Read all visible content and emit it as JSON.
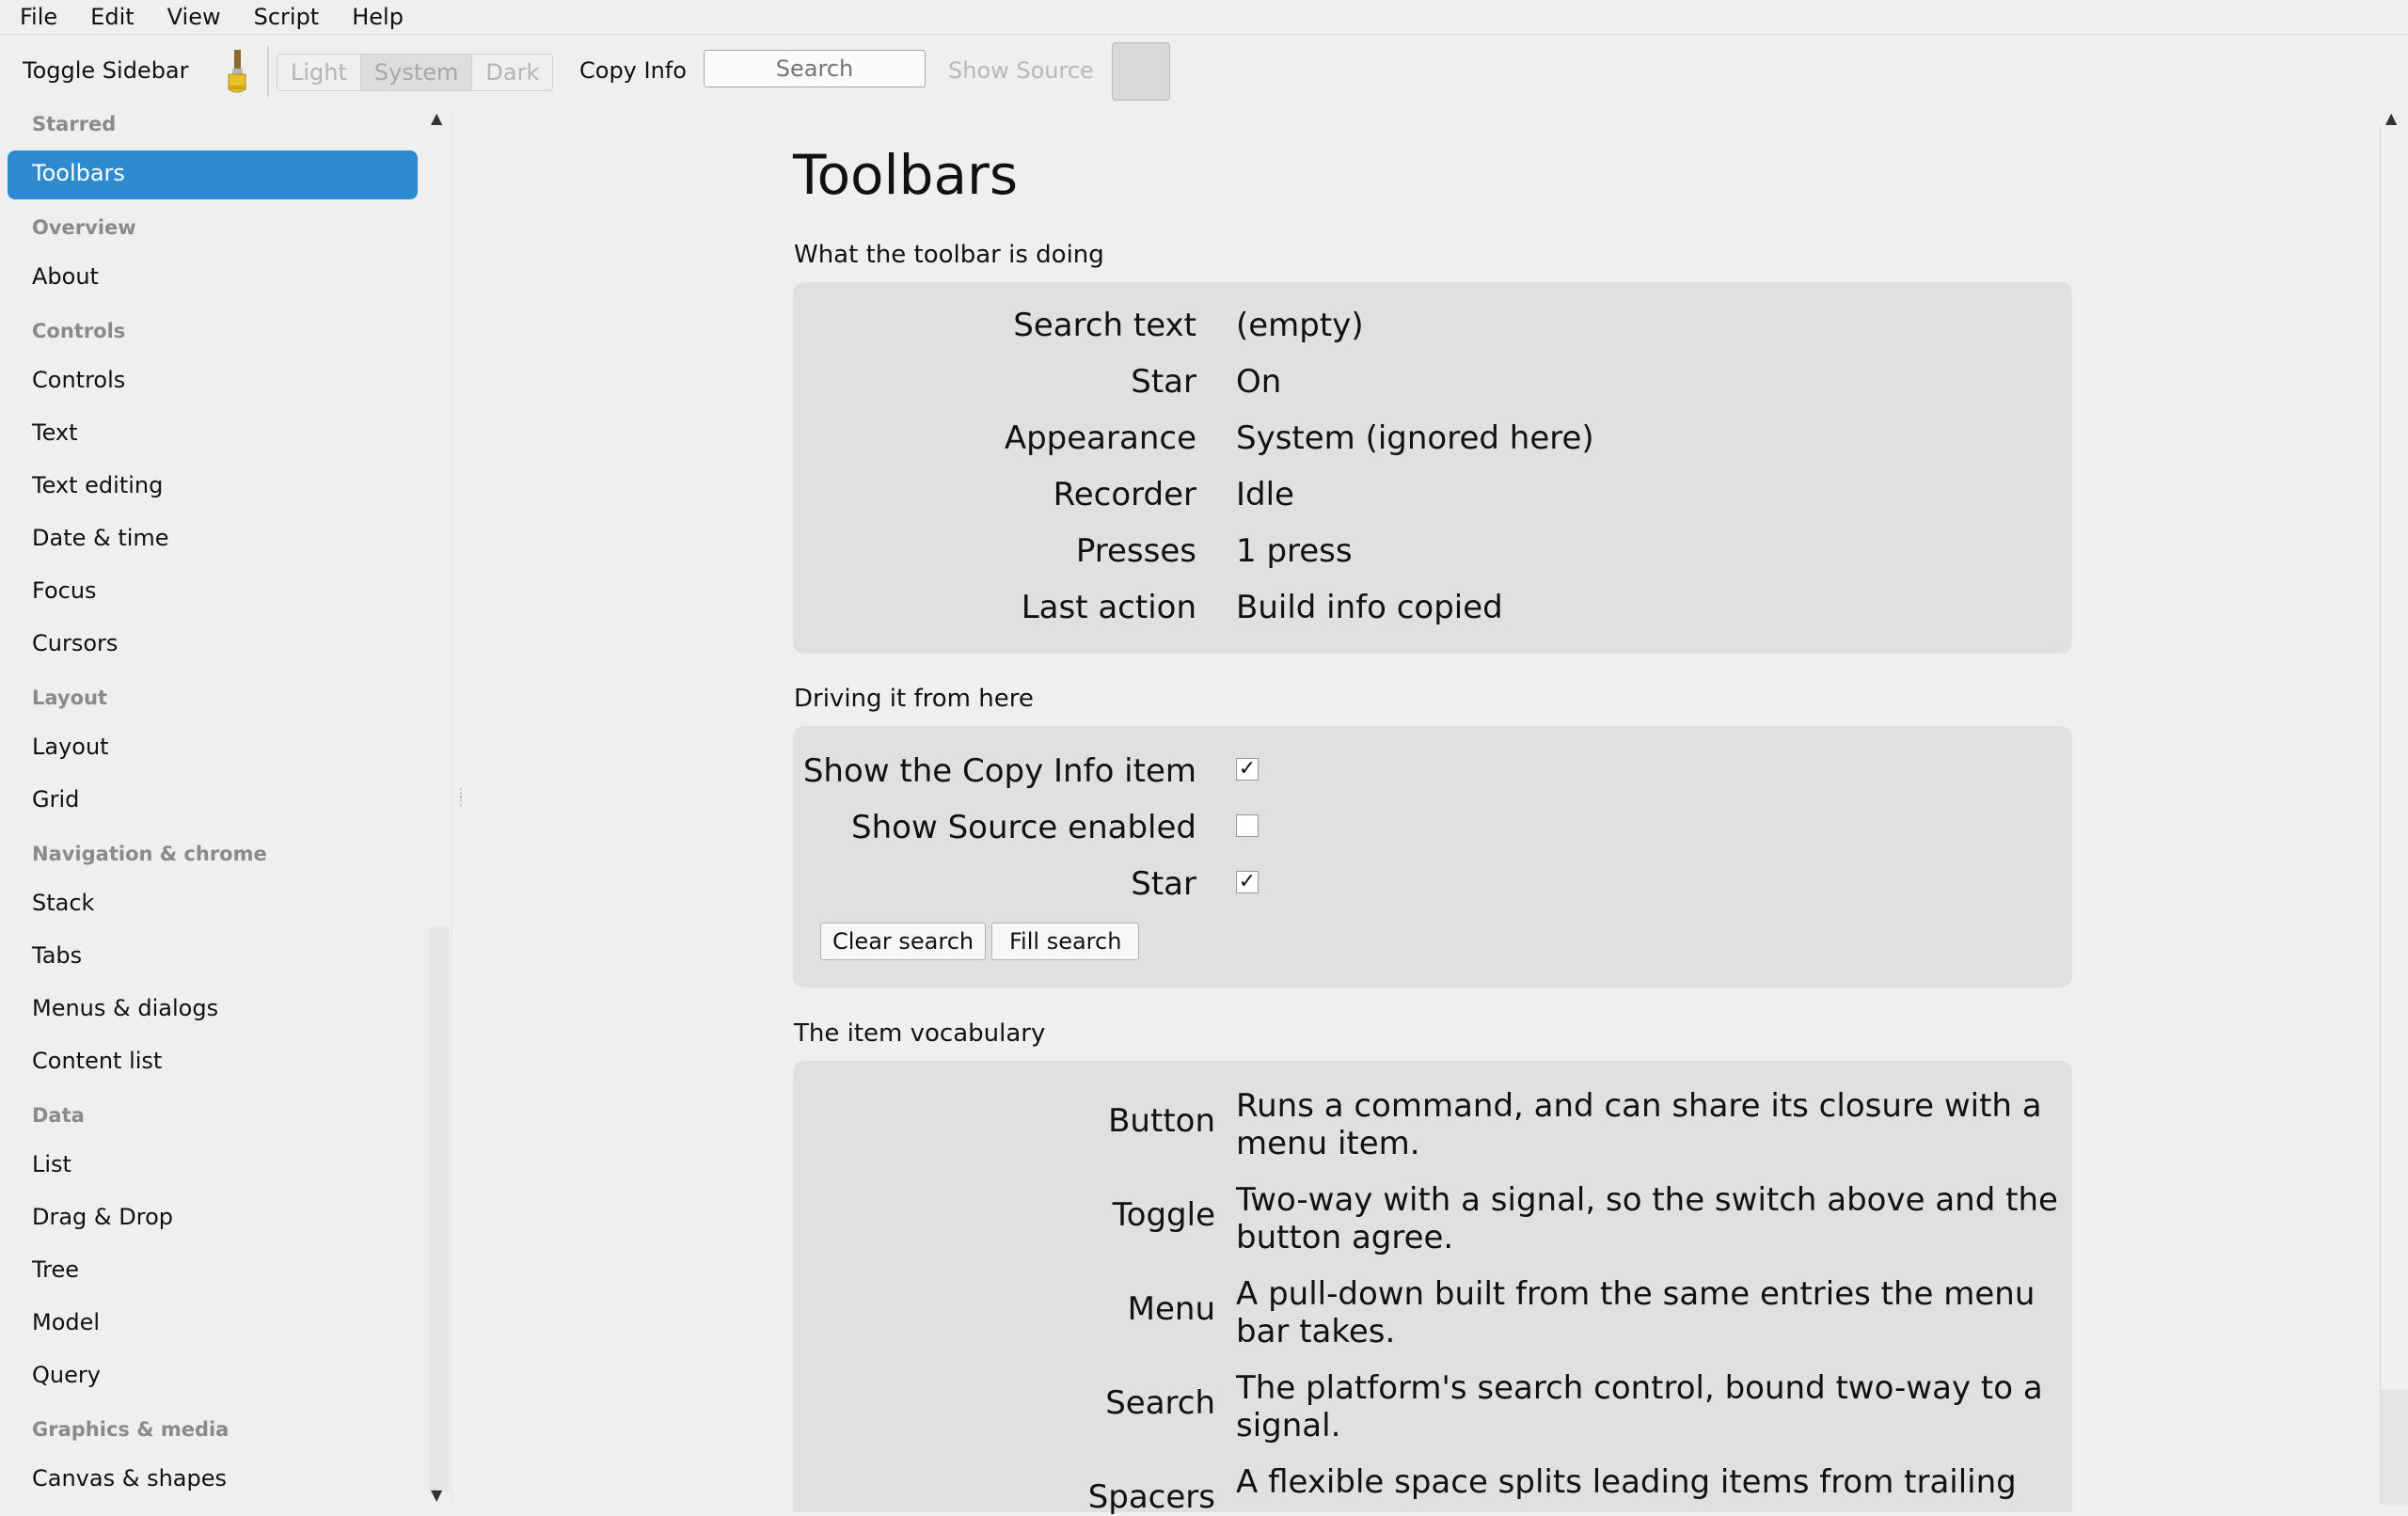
{
  "menubar": [
    "File",
    "Edit",
    "View",
    "Script",
    "Help"
  ],
  "toolbar": {
    "toggle_sidebar": "Toggle Sidebar",
    "brush_icon": "paintbrush-icon",
    "appearance": [
      "Light",
      "System",
      "Dark"
    ],
    "appearance_selected": "System",
    "copy_info": "Copy Info",
    "search_placeholder": "Search",
    "show_source": "Show Source",
    "star_button": "star-toggle"
  },
  "sidebar": {
    "sections": [
      {
        "title": "Starred",
        "items": [
          "Toolbars"
        ]
      },
      {
        "title": "Overview",
        "items": [
          "About"
        ]
      },
      {
        "title": "Controls",
        "items": [
          "Controls",
          "Text",
          "Text editing",
          "Date & time",
          "Focus",
          "Cursors"
        ]
      },
      {
        "title": "Layout",
        "items": [
          "Layout",
          "Grid"
        ]
      },
      {
        "title": "Navigation & chrome",
        "items": [
          "Stack",
          "Tabs",
          "Menus & dialogs",
          "Content list"
        ]
      },
      {
        "title": "Data",
        "items": [
          "List",
          "Drag & Drop",
          "Tree",
          "Model",
          "Query"
        ]
      },
      {
        "title": "Graphics & media",
        "items": [
          "Canvas & shapes"
        ]
      }
    ],
    "selected": "Toolbars"
  },
  "main": {
    "title": "Toolbars",
    "status_caption": "What the toolbar is doing",
    "status": [
      {
        "label": "Search text",
        "value": "(empty)"
      },
      {
        "label": "Star",
        "value": "On"
      },
      {
        "label": "Appearance",
        "value": "System (ignored here)"
      },
      {
        "label": "Recorder",
        "value": "Idle"
      },
      {
        "label": "Presses",
        "value": "1 press"
      },
      {
        "label": "Last action",
        "value": "Build info copied"
      }
    ],
    "drive_caption": "Driving it from here",
    "drive": [
      {
        "label": "Show the Copy Info item",
        "checked": true
      },
      {
        "label": "Show Source enabled",
        "checked": false
      },
      {
        "label": "Star",
        "checked": true
      }
    ],
    "buttons": {
      "clear": "Clear search",
      "fill": "Fill search"
    },
    "vocab_caption": "The item vocabulary",
    "vocab": [
      {
        "term": "Button",
        "desc": "Runs a command, and can share its closure with a menu item."
      },
      {
        "term": "Toggle",
        "desc": "Two-way with a signal, so the switch above and the button agree."
      },
      {
        "term": "Menu",
        "desc": "A pull-down built from the same entries the menu bar takes."
      },
      {
        "term": "Search",
        "desc": "The platform's search control, bound two-way to a signal."
      },
      {
        "term": "Spacers",
        "desc": "A flexible space splits leading items from trailing"
      }
    ],
    "check_glyph": "✓"
  }
}
